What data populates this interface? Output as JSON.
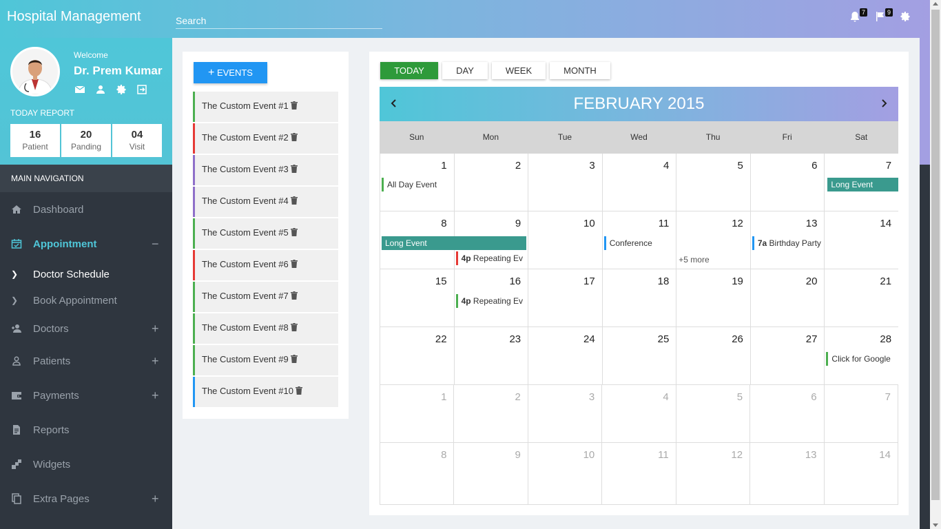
{
  "app": {
    "title": "Hospital Management"
  },
  "search": {
    "placeholder": "Search"
  },
  "top_icons": {
    "notifications_count": "7",
    "flags_count": "9"
  },
  "profile": {
    "welcome": "Welcome",
    "name": "Dr. Prem Kumar",
    "today_report": "TODAY REPORT",
    "stats": [
      {
        "num": "16",
        "label": "Patient"
      },
      {
        "num": "20",
        "label": "Panding"
      },
      {
        "num": "04",
        "label": "Visit"
      }
    ]
  },
  "nav": {
    "heading": "MAIN NAVIGATION",
    "dashboard": "Dashboard",
    "appointment": "Appointment",
    "doctor_schedule": "Doctor Schedule",
    "book_appointment": "Book Appointment",
    "doctors": "Doctors",
    "patients": "Patients",
    "payments": "Payments",
    "reports": "Reports",
    "widgets": "Widgets",
    "extra_pages": "Extra Pages",
    "plus": "+",
    "minus": "−"
  },
  "events": {
    "add_label": "EVENTS",
    "items": [
      {
        "label": "The Custom Event #1",
        "color": "#4caf50"
      },
      {
        "label": "The Custom Event #2",
        "color": "#e53935"
      },
      {
        "label": "The Custom Event #3",
        "color": "#8e6fc9"
      },
      {
        "label": "The Custom Event #4",
        "color": "#8e6fc9"
      },
      {
        "label": "The Custom Event #5",
        "color": "#4caf50"
      },
      {
        "label": "The Custom Event #6",
        "color": "#e53935"
      },
      {
        "label": "The Custom Event #7",
        "color": "#4caf50"
      },
      {
        "label": "The Custom Event #8",
        "color": "#4caf50"
      },
      {
        "label": "The Custom Event #9",
        "color": "#4caf50"
      },
      {
        "label": "The Custom Event #10",
        "color": "#2196f3"
      }
    ]
  },
  "calendar": {
    "views": {
      "today": "TODAY",
      "day": "DAY",
      "week": "WEEK",
      "month": "MONTH"
    },
    "title": "FEBRUARY 2015",
    "dow": [
      "Sun",
      "Mon",
      "Tue",
      "Wed",
      "Thu",
      "Fri",
      "Sat"
    ],
    "weeks": [
      [
        "1",
        "2",
        "3",
        "4",
        "5",
        "6",
        "7"
      ],
      [
        "8",
        "9",
        "10",
        "11",
        "12",
        "13",
        "14"
      ],
      [
        "15",
        "16",
        "17",
        "18",
        "19",
        "20",
        "21"
      ],
      [
        "22",
        "23",
        "24",
        "25",
        "26",
        "27",
        "28"
      ],
      [
        "1",
        "2",
        "3",
        "4",
        "5",
        "6",
        "7"
      ],
      [
        "8",
        "9",
        "10",
        "11",
        "12",
        "13",
        "14"
      ]
    ],
    "events": {
      "all_day": "All Day Event",
      "long_event": "Long Event",
      "repeating_time": "4p",
      "repeating": "Repeating Ev",
      "conference": "Conference",
      "birthday_time": "7a",
      "birthday": "Birthday Party",
      "more": "+5 more",
      "google": "Click for Google"
    }
  }
}
